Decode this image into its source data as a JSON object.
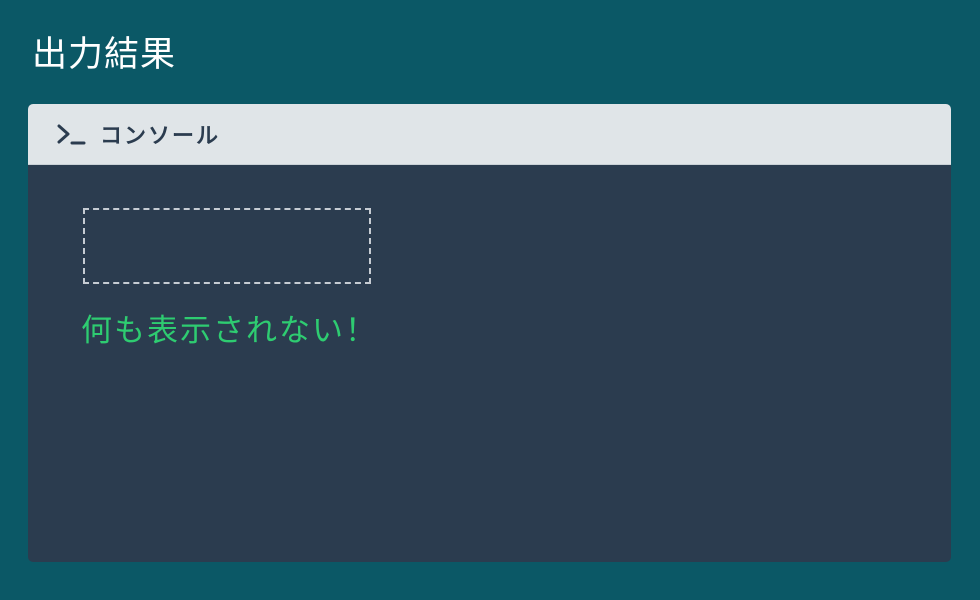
{
  "page": {
    "title": "出力結果"
  },
  "console": {
    "icon": "terminal-prompt-icon",
    "title": "コンソール",
    "empty_message": "何も表示されない！"
  },
  "colors": {
    "background": "#0b5866",
    "header_bg": "#e0e5e8",
    "console_bg": "#2b3c4f",
    "message": "#2ecc71"
  }
}
